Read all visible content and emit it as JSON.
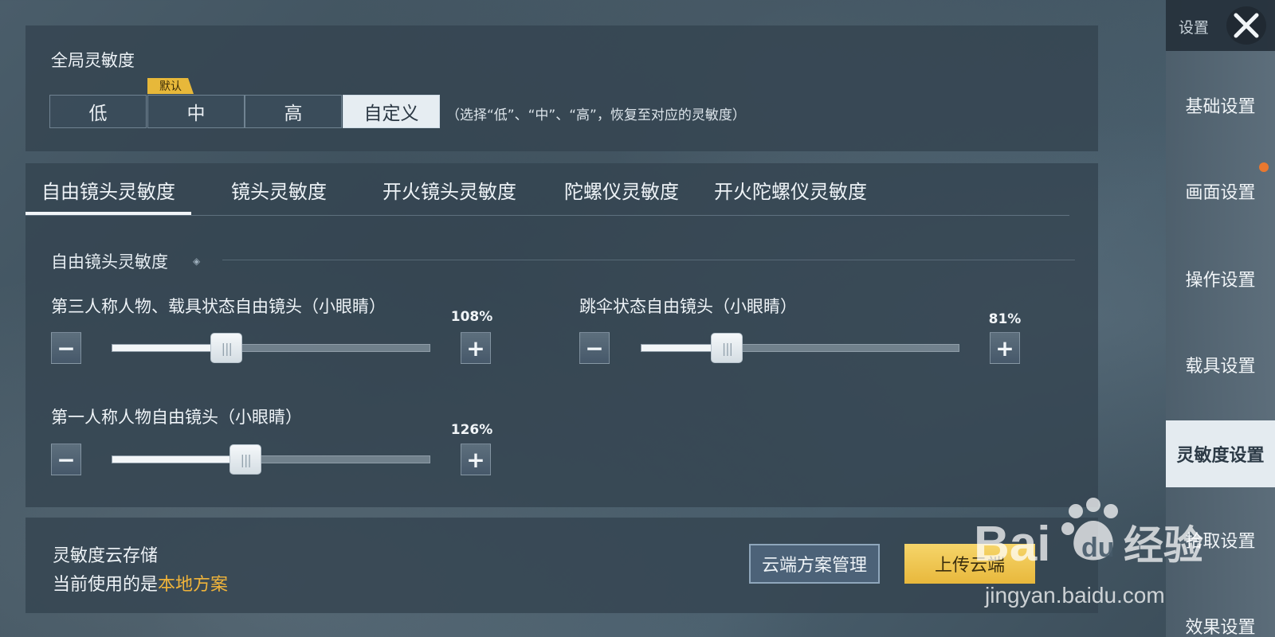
{
  "global": {
    "title": "全局灵敏度",
    "badge": "默认",
    "options": [
      "低",
      "中",
      "高",
      "自定义"
    ],
    "selected": "自定义",
    "hint": "（选择“低”、“中”、“高”，恢复至对应的灵敏度）"
  },
  "tabs": [
    {
      "label": "自由镜头灵敏度",
      "active": true
    },
    {
      "label": "镜头灵敏度",
      "active": false
    },
    {
      "label": "开火镜头灵敏度",
      "active": false
    },
    {
      "label": "陀螺仪灵敏度",
      "active": false
    },
    {
      "label": "开火陀螺仪灵敏度",
      "active": false
    }
  ],
  "section_title": "自由镜头灵敏度",
  "sliders": [
    {
      "label": "第三人称人物、载具状态自由镜头（小眼睛）",
      "value_text": "108%",
      "fraction": 0.36
    },
    {
      "label": "跳伞状态自由镜头（小眼睛）",
      "value_text": "81%",
      "fraction": 0.27
    },
    {
      "label": "第一人称人物自由镜头（小眼睛）",
      "value_text": "126%",
      "fraction": 0.42
    }
  ],
  "cloud": {
    "title": "灵敏度云存储",
    "current_prefix": "当前使用的是",
    "current_value": "本地方案",
    "manage_button": "云端方案管理",
    "upload_button": "上传云端"
  },
  "sidebar": {
    "title": "设置",
    "items": [
      "基础设置",
      "画面设置",
      "操作设置",
      "载具设置",
      "灵敏度设置",
      "拾取设置",
      "效果设置"
    ],
    "active": "灵敏度设置"
  },
  "watermark": {
    "text": "Bai du 经验",
    "url": "jingyan.baidu.com"
  },
  "colors": {
    "accent": "#e7b83a",
    "highlight": "#f0b43a",
    "notify": "#e9782f",
    "panel": "#344450"
  }
}
